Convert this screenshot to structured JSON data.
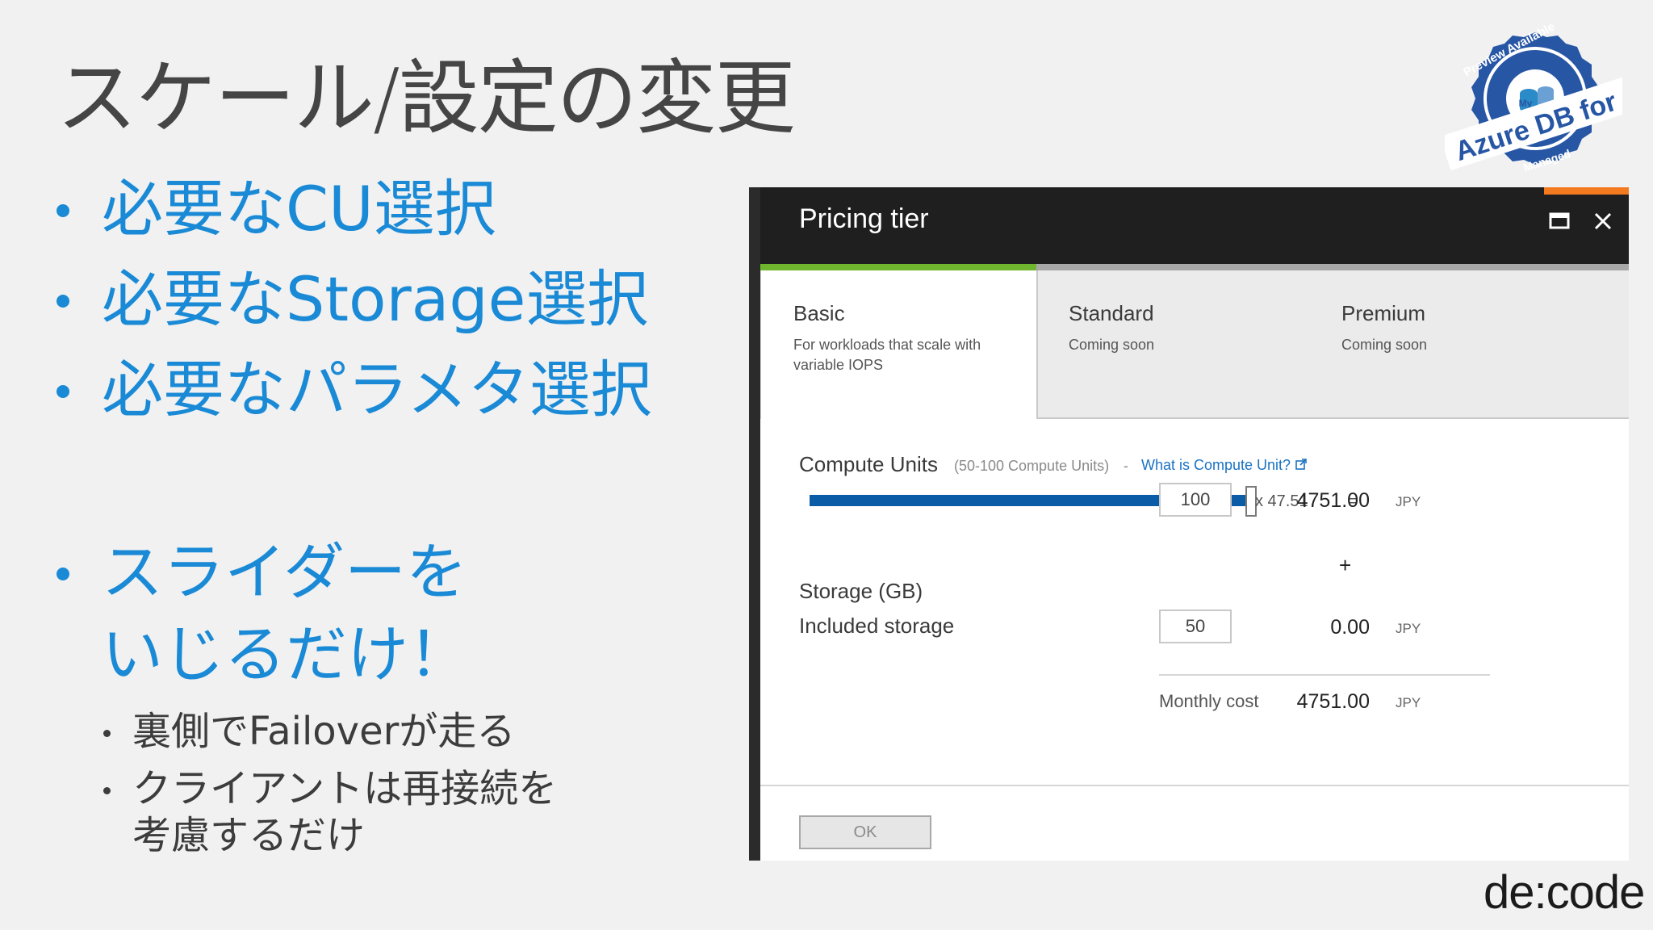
{
  "slide": {
    "title": "スケール/設定の変更",
    "bullets": [
      "必要なCU選択",
      "必要なStorage選択",
      "必要なパラメタ選択"
    ],
    "slider_bullet": [
      "スライダーを",
      "いじるだけ！"
    ],
    "sub_bullets": [
      "裏側でFailoverが走る",
      "クライアントは再接続を",
      "考慮するだけ"
    ]
  },
  "badge": {
    "top_text": "Preview Available",
    "main_text": "Azure DB for",
    "bottom_text": "Managed",
    "icon_label": "My"
  },
  "blade": {
    "title": "Pricing tier",
    "maximize_icon": "maximize-icon",
    "close_icon": "close-icon",
    "accent_color": "#f47a20",
    "tiers": [
      {
        "name": "Basic",
        "desc_line1": "For workloads that scale with",
        "desc_line2": "variable IOPS"
      },
      {
        "name": "Standard",
        "desc": "Coming soon"
      },
      {
        "name": "Premium",
        "desc": "Coming soon"
      }
    ],
    "compute": {
      "label": "Compute Units",
      "range": "(50-100 Compute Units)",
      "separator": "-",
      "link": "What is Compute Unit?",
      "value": "100",
      "slider_fraction": 1.0,
      "multiplier": "x 47.51",
      "equals": "=",
      "amount": "4751.00",
      "currency": "JPY"
    },
    "plus": "+",
    "storage": {
      "label": "Storage (GB)",
      "sublabel": "Included storage",
      "value": "50",
      "amount": "0.00",
      "currency": "JPY"
    },
    "monthly": {
      "label": "Monthly cost",
      "amount": "4751.00",
      "currency": "JPY"
    },
    "ok": "OK"
  },
  "brand": "de:code",
  "colors": {
    "bullet_blue": "#1a8ad6",
    "slider_blue": "#0a5ca6",
    "tier_green": "#6fb52e",
    "badge_blue": "#2756a5"
  }
}
